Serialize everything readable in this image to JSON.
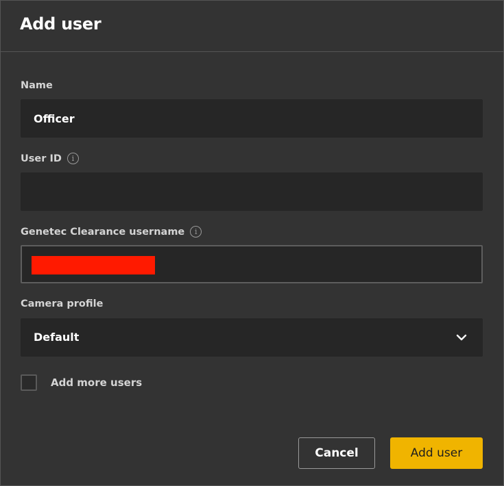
{
  "dialog": {
    "title": "Add user"
  },
  "fields": {
    "name": {
      "label": "Name",
      "value": "Officer"
    },
    "user_id": {
      "label": "User ID",
      "value": ""
    },
    "clearance_username": {
      "label": "Genetec Clearance username",
      "value": ""
    },
    "camera_profile": {
      "label": "Camera profile",
      "selected": "Default"
    }
  },
  "add_more": {
    "label": "Add more users",
    "checked": false
  },
  "buttons": {
    "cancel": "Cancel",
    "submit": "Add user"
  },
  "icons": {
    "info": "info-icon",
    "dropdown": "chevron-down-icon"
  },
  "colors": {
    "background": "#333333",
    "field_bg": "#262626",
    "accent": "#f0b400",
    "redaction": "#ff1a00"
  }
}
